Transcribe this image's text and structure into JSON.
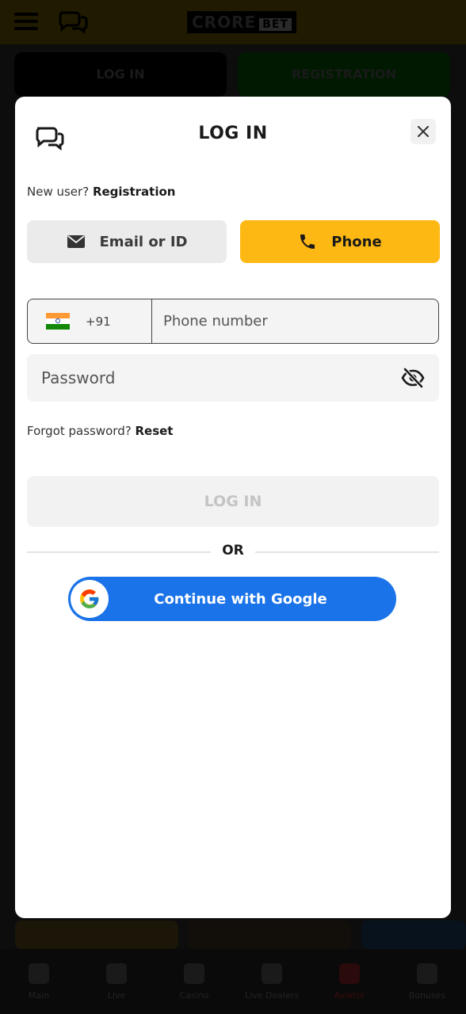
{
  "background": {
    "logo": "CRORE",
    "logo_badge": "BET",
    "login_button": "LOG IN",
    "registration_button": "REGISTRATION",
    "bottom_nav": [
      "Main",
      "Live",
      "Casino",
      "Live Dealers",
      "Aviator",
      "Bonuses"
    ],
    "active_nav_index": 4
  },
  "modal": {
    "title": "LOG IN",
    "new_user_prompt": "New user?",
    "registration_link": "Registration",
    "tabs": {
      "email": "Email or ID",
      "phone": "Phone",
      "active": "phone"
    },
    "phone": {
      "country_code": "+91",
      "placeholder": "Phone number",
      "value": ""
    },
    "password": {
      "placeholder": "Password",
      "value": ""
    },
    "forgot_prompt": "Forgot password?",
    "reset_link": "Reset",
    "login_button": "LOG IN",
    "divider_text": "OR",
    "google_button": "Continue with Google"
  },
  "colors": {
    "accent": "#fdb813",
    "google_blue": "#1a73e8"
  }
}
